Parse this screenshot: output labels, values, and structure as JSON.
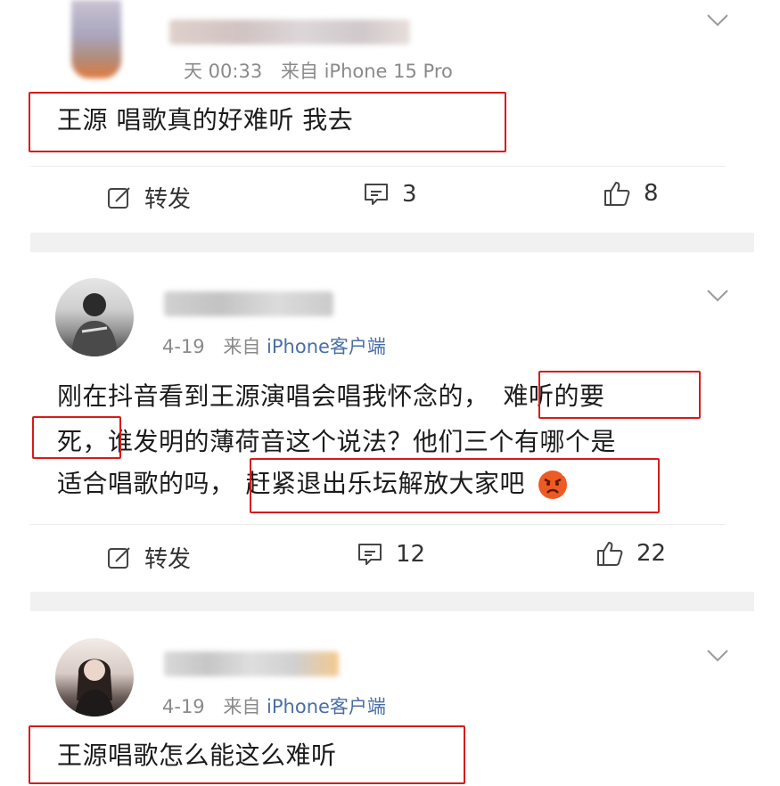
{
  "posts": [
    {
      "timestamp": "天 00:33",
      "source_prefix": "来自",
      "source_device": "iPhone 15 Pro",
      "text": "王源 唱歌真的好难听 我去",
      "actions": {
        "repost": "转发",
        "comments": "3",
        "likes": "8"
      }
    },
    {
      "timestamp": "4-19",
      "source_prefix": "来自",
      "source_device": "iPhone客户端",
      "text_line1_a": "刚在抖音看到王源演唱会唱我怀念的，",
      "text_line1_b": "难听的要",
      "text_line2_a": "死，",
      "text_line2_b": "谁发明的薄荷音这个说法？他们三个有哪个是",
      "text_line3_a": "适合唱歌的吗，",
      "text_line3_b": "赶紧退出乐坛解放大家吧",
      "emoji": "angry-face-emoji",
      "actions": {
        "repost": "转发",
        "comments": "12",
        "likes": "22"
      }
    },
    {
      "timestamp": "4-19",
      "source_prefix": "来自",
      "source_device": "iPhone客户端",
      "text": "王源唱歌怎么能这么难听"
    }
  ],
  "colors": {
    "highlight_box": "#d91a1a",
    "meta_gray": "#8a8a8a",
    "source_blue": "#4a6fa5",
    "separator": "#f1f1f1"
  }
}
